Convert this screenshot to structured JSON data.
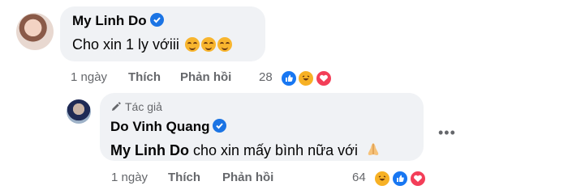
{
  "comment": {
    "author": "My Linh Do",
    "text": "Cho xin 1 ly vớiii",
    "time": "1 ngày",
    "like_label": "Thích",
    "reply_label": "Phản hồi",
    "reaction_count": "28",
    "reactions": [
      "like",
      "haha",
      "love"
    ]
  },
  "reply": {
    "badge": "Tác giả",
    "author": "Do Vinh Quang",
    "mention": "My Linh Do",
    "text": " cho xin mấy bình nữa với",
    "time": "1 ngày",
    "like_label": "Thích",
    "reply_label": "Phản hồi",
    "reaction_count": "64",
    "reactions": [
      "haha",
      "like",
      "love"
    ],
    "more_label": "•••"
  },
  "colors": {
    "bubble": "#f0f2f5",
    "meta": "#65676b",
    "verified": "#1b74e4",
    "like": "#1877f2",
    "haha": "#f7b125",
    "love": "#f33e58"
  }
}
